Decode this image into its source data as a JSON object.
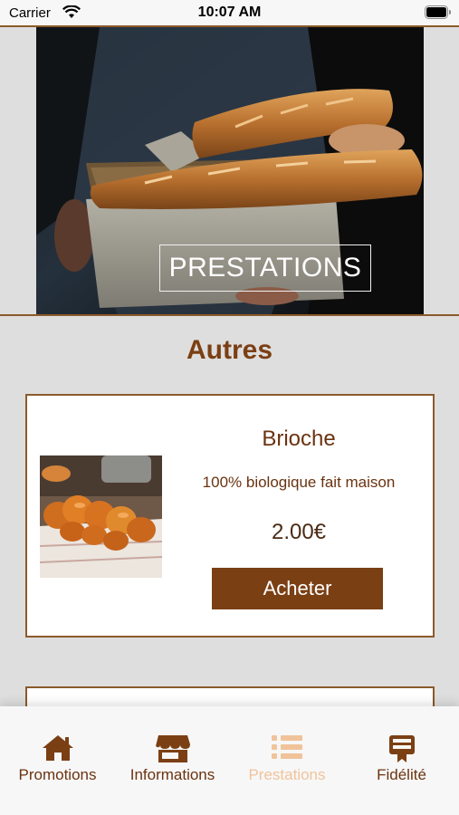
{
  "status_bar": {
    "carrier": "Carrier",
    "time": "10:07 AM"
  },
  "hero": {
    "title": "PRESTATIONS"
  },
  "section": {
    "title": "Autres"
  },
  "products": [
    {
      "name": "Brioche",
      "description": "100% biologique fait maison",
      "price": "2.00€",
      "buy_label": "Acheter"
    }
  ],
  "tabs": [
    {
      "label": "Promotions",
      "icon": "home-icon"
    },
    {
      "label": "Informations",
      "icon": "store-icon"
    },
    {
      "label": "Prestations",
      "icon": "list-icon",
      "active": true
    },
    {
      "label": "Fidélité",
      "icon": "loyalty-card-icon"
    }
  ],
  "colors": {
    "brand": "#7b3f14",
    "active_tab": "#f0c39a",
    "background": "#dedede"
  }
}
